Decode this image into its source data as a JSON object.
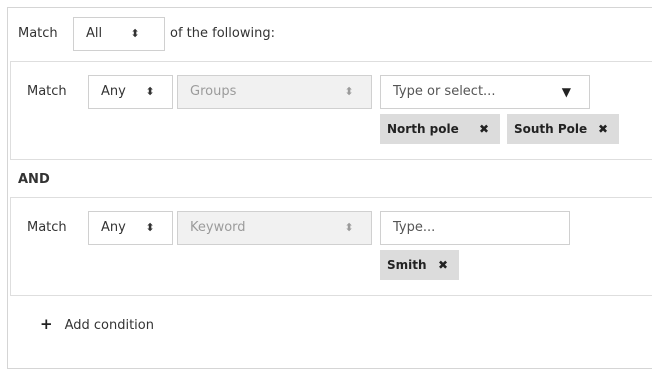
{
  "top": {
    "match_label": "Match",
    "match_value": "All",
    "suffix": "of the following:"
  },
  "condition1": {
    "match_label": "Match",
    "match_value": "Any",
    "field_value": "Groups",
    "input_placeholder": "Type or select...",
    "tags": [
      "North pole",
      "South Pole"
    ]
  },
  "operator": "AND",
  "condition2": {
    "match_label": "Match",
    "match_value": "Any",
    "field_value": "Keyword",
    "input_placeholder": "Type...",
    "tags": [
      "Smith"
    ]
  },
  "add_condition": {
    "icon": "plus-icon",
    "label": "Add condition"
  },
  "icons": {
    "select_caret": "up-down-caret-icon",
    "dropdown_arrow": "triangle-down-icon",
    "tag_remove": "close-icon"
  },
  "colors": {
    "border": "#d0d0d0",
    "disabled_bg": "#f1f1f1",
    "tag_bg": "#dcdcdc",
    "text": "#333333"
  }
}
